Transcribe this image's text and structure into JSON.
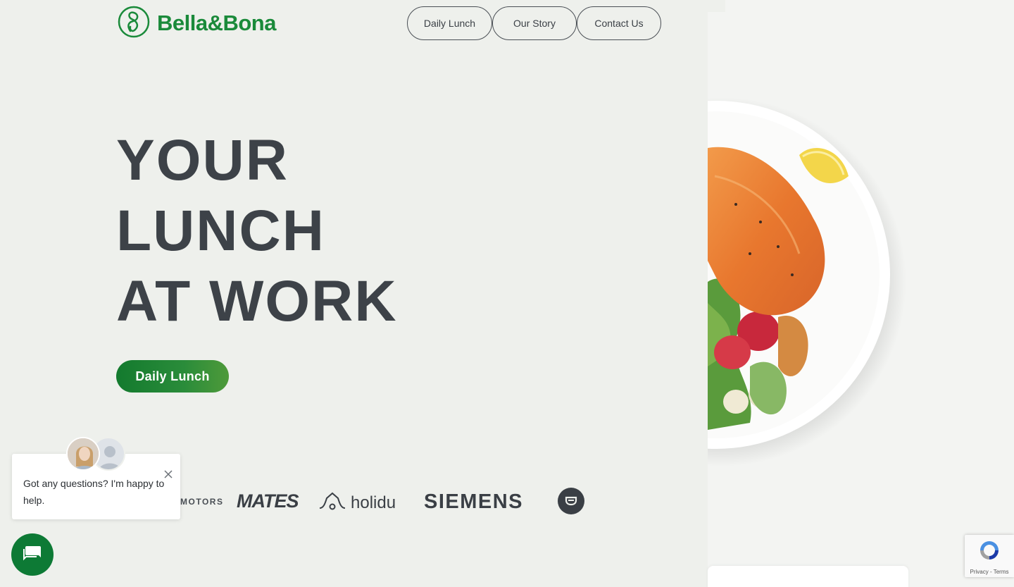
{
  "brand": {
    "name": "Bella&Bona",
    "accent_color": "#1a8a3a",
    "logo_icon": "bella-bona-logo-icon"
  },
  "nav": {
    "items": [
      {
        "label": "Daily Lunch"
      },
      {
        "label": "Our Story"
      },
      {
        "label": "Contact Us"
      }
    ]
  },
  "hero": {
    "title_lines": [
      "YOUR",
      "LUNCH",
      "AT WORK"
    ],
    "cta_label": "Daily Lunch",
    "image": "salmon-plate-image"
  },
  "client_logos": {
    "items": [
      {
        "label": "MOTORS"
      },
      {
        "label": "MATES"
      },
      {
        "label": "holidu"
      },
      {
        "label": "SIEMENS"
      }
    ]
  },
  "chat": {
    "message": "Got any questions? I'm happy to help.",
    "close_icon": "close-icon",
    "launcher_icon": "chat-icon"
  },
  "recaptcha": {
    "links": "Privacy - Terms"
  }
}
